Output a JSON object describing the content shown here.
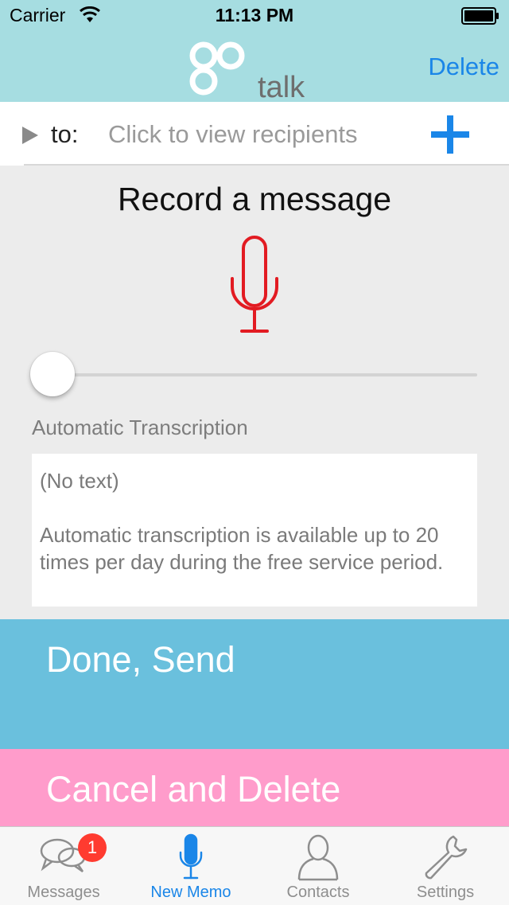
{
  "status_bar": {
    "carrier": "Carrier",
    "time": "11:13 PM"
  },
  "nav": {
    "logo_text_go": "go",
    "logo_text_talk": "talk",
    "delete_label": "Delete"
  },
  "recipients": {
    "to_label": "to:",
    "placeholder": "Click to view recipients"
  },
  "record": {
    "title": "Record a message",
    "progress": 0
  },
  "transcription": {
    "label": "Automatic Transcription",
    "no_text": "(No text)",
    "notice": "Automatic transcription is available up to 20 times per day during the free service period."
  },
  "actions": {
    "send_label": "Done, Send",
    "cancel_label": "Cancel and Delete"
  },
  "tabs": [
    {
      "label": "Messages",
      "icon": "chat-bubbles-icon",
      "badge": "1"
    },
    {
      "label": "New Memo",
      "icon": "microphone-icon",
      "active": true
    },
    {
      "label": "Contacts",
      "icon": "person-icon"
    },
    {
      "label": "Settings",
      "icon": "wrench-icon"
    }
  ],
  "colors": {
    "header_bg": "#a6dde1",
    "accent_blue": "#1a86e8",
    "record_red": "#e21b22",
    "send_bg": "#6ac0dd",
    "cancel_bg": "#ff9ccb",
    "badge_red": "#ff3b30"
  }
}
